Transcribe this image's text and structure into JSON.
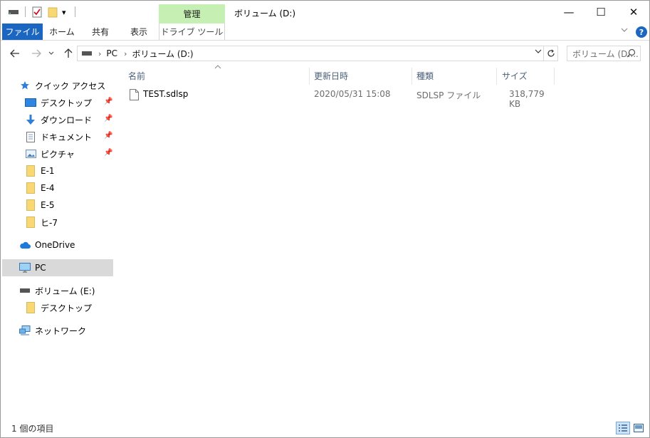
{
  "window": {
    "title": "ボリューム (D:)",
    "context_tab_header": "管理",
    "buttons": {
      "minimize": "—",
      "maximize": "☐",
      "close": "✕"
    }
  },
  "quick_access_toolbar": {
    "dropdown": "▾"
  },
  "ribbon": {
    "tabs": [
      {
        "label": "ファイル"
      },
      {
        "label": "ホーム"
      },
      {
        "label": "共有"
      },
      {
        "label": "表示"
      },
      {
        "label": "ドライブ ツール"
      }
    ],
    "help": "?"
  },
  "address": {
    "breadcrumbs": [
      "PC",
      "ボリューム (D:)"
    ],
    "search_placeholder": "ボリューム (D:..."
  },
  "nav_pane": {
    "items": [
      {
        "label": "クイック アクセス",
        "icon": "star-icon"
      },
      {
        "label": "デスクトップ",
        "icon": "desktop-icon",
        "pinned": true
      },
      {
        "label": "ダウンロード",
        "icon": "download-arrow-icon",
        "pinned": true
      },
      {
        "label": "ドキュメント",
        "icon": "document-icon",
        "pinned": true
      },
      {
        "label": "ピクチャ",
        "icon": "picture-icon",
        "pinned": true
      },
      {
        "label": "E-1",
        "icon": "folder-icon"
      },
      {
        "label": "E-4",
        "icon": "folder-icon"
      },
      {
        "label": "E-5",
        "icon": "folder-icon"
      },
      {
        "label": "ヒ-7",
        "icon": "folder-icon"
      },
      {
        "label": "OneDrive",
        "icon": "cloud-icon"
      },
      {
        "label": "PC",
        "icon": "monitor-icon",
        "selected": true
      },
      {
        "label": "ボリューム (E:)",
        "icon": "drive-icon"
      },
      {
        "label": "デスクトップ",
        "icon": "folder-icon"
      },
      {
        "label": "ネットワーク",
        "icon": "network-icon"
      }
    ]
  },
  "file_list": {
    "columns": [
      "名前",
      "更新日時",
      "種類",
      "サイズ"
    ],
    "rows": [
      {
        "name": "TEST.sdlsp",
        "modified": "2020/05/31 15:08",
        "type": "SDLSP ファイル",
        "size": "318,779 KB"
      }
    ]
  },
  "status": {
    "item_count": "1 個の項目"
  },
  "colors": {
    "file_tab": "#1a66c0",
    "manage_tab": "#c6efb4",
    "selection": "#d9d9d9",
    "column_header": "#4c607a",
    "folder": "#f8d775"
  }
}
